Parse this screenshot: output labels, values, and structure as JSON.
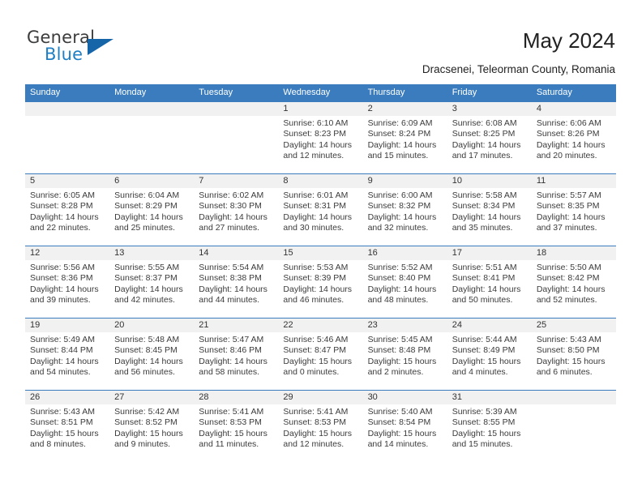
{
  "brand": {
    "name_top": "General",
    "name_bottom": "Blue",
    "accent_color": "#1f7fc4",
    "triangle_color": "#1565a8"
  },
  "header": {
    "title": "May 2024",
    "subtitle": "Dracsenei, Teleorman County, Romania"
  },
  "calendar": {
    "header_color": "#3a7cbe",
    "daynum_band_color": "#f1f1f1",
    "weekdays": [
      "Sunday",
      "Monday",
      "Tuesday",
      "Wednesday",
      "Thursday",
      "Friday",
      "Saturday"
    ],
    "weeks": [
      [
        {
          "day": "",
          "empty": true
        },
        {
          "day": "",
          "empty": true
        },
        {
          "day": "",
          "empty": true
        },
        {
          "day": "1",
          "sunrise": "Sunrise: 6:10 AM",
          "sunset": "Sunset: 8:23 PM",
          "daylight_l1": "Daylight: 14 hours",
          "daylight_l2": "and 12 minutes."
        },
        {
          "day": "2",
          "sunrise": "Sunrise: 6:09 AM",
          "sunset": "Sunset: 8:24 PM",
          "daylight_l1": "Daylight: 14 hours",
          "daylight_l2": "and 15 minutes."
        },
        {
          "day": "3",
          "sunrise": "Sunrise: 6:08 AM",
          "sunset": "Sunset: 8:25 PM",
          "daylight_l1": "Daylight: 14 hours",
          "daylight_l2": "and 17 minutes."
        },
        {
          "day": "4",
          "sunrise": "Sunrise: 6:06 AM",
          "sunset": "Sunset: 8:26 PM",
          "daylight_l1": "Daylight: 14 hours",
          "daylight_l2": "and 20 minutes."
        }
      ],
      [
        {
          "day": "5",
          "sunrise": "Sunrise: 6:05 AM",
          "sunset": "Sunset: 8:28 PM",
          "daylight_l1": "Daylight: 14 hours",
          "daylight_l2": "and 22 minutes."
        },
        {
          "day": "6",
          "sunrise": "Sunrise: 6:04 AM",
          "sunset": "Sunset: 8:29 PM",
          "daylight_l1": "Daylight: 14 hours",
          "daylight_l2": "and 25 minutes."
        },
        {
          "day": "7",
          "sunrise": "Sunrise: 6:02 AM",
          "sunset": "Sunset: 8:30 PM",
          "daylight_l1": "Daylight: 14 hours",
          "daylight_l2": "and 27 minutes."
        },
        {
          "day": "8",
          "sunrise": "Sunrise: 6:01 AM",
          "sunset": "Sunset: 8:31 PM",
          "daylight_l1": "Daylight: 14 hours",
          "daylight_l2": "and 30 minutes."
        },
        {
          "day": "9",
          "sunrise": "Sunrise: 6:00 AM",
          "sunset": "Sunset: 8:32 PM",
          "daylight_l1": "Daylight: 14 hours",
          "daylight_l2": "and 32 minutes."
        },
        {
          "day": "10",
          "sunrise": "Sunrise: 5:58 AM",
          "sunset": "Sunset: 8:34 PM",
          "daylight_l1": "Daylight: 14 hours",
          "daylight_l2": "and 35 minutes."
        },
        {
          "day": "11",
          "sunrise": "Sunrise: 5:57 AM",
          "sunset": "Sunset: 8:35 PM",
          "daylight_l1": "Daylight: 14 hours",
          "daylight_l2": "and 37 minutes."
        }
      ],
      [
        {
          "day": "12",
          "sunrise": "Sunrise: 5:56 AM",
          "sunset": "Sunset: 8:36 PM",
          "daylight_l1": "Daylight: 14 hours",
          "daylight_l2": "and 39 minutes."
        },
        {
          "day": "13",
          "sunrise": "Sunrise: 5:55 AM",
          "sunset": "Sunset: 8:37 PM",
          "daylight_l1": "Daylight: 14 hours",
          "daylight_l2": "and 42 minutes."
        },
        {
          "day": "14",
          "sunrise": "Sunrise: 5:54 AM",
          "sunset": "Sunset: 8:38 PM",
          "daylight_l1": "Daylight: 14 hours",
          "daylight_l2": "and 44 minutes."
        },
        {
          "day": "15",
          "sunrise": "Sunrise: 5:53 AM",
          "sunset": "Sunset: 8:39 PM",
          "daylight_l1": "Daylight: 14 hours",
          "daylight_l2": "and 46 minutes."
        },
        {
          "day": "16",
          "sunrise": "Sunrise: 5:52 AM",
          "sunset": "Sunset: 8:40 PM",
          "daylight_l1": "Daylight: 14 hours",
          "daylight_l2": "and 48 minutes."
        },
        {
          "day": "17",
          "sunrise": "Sunrise: 5:51 AM",
          "sunset": "Sunset: 8:41 PM",
          "daylight_l1": "Daylight: 14 hours",
          "daylight_l2": "and 50 minutes."
        },
        {
          "day": "18",
          "sunrise": "Sunrise: 5:50 AM",
          "sunset": "Sunset: 8:42 PM",
          "daylight_l1": "Daylight: 14 hours",
          "daylight_l2": "and 52 minutes."
        }
      ],
      [
        {
          "day": "19",
          "sunrise": "Sunrise: 5:49 AM",
          "sunset": "Sunset: 8:44 PM",
          "daylight_l1": "Daylight: 14 hours",
          "daylight_l2": "and 54 minutes."
        },
        {
          "day": "20",
          "sunrise": "Sunrise: 5:48 AM",
          "sunset": "Sunset: 8:45 PM",
          "daylight_l1": "Daylight: 14 hours",
          "daylight_l2": "and 56 minutes."
        },
        {
          "day": "21",
          "sunrise": "Sunrise: 5:47 AM",
          "sunset": "Sunset: 8:46 PM",
          "daylight_l1": "Daylight: 14 hours",
          "daylight_l2": "and 58 minutes."
        },
        {
          "day": "22",
          "sunrise": "Sunrise: 5:46 AM",
          "sunset": "Sunset: 8:47 PM",
          "daylight_l1": "Daylight: 15 hours",
          "daylight_l2": "and 0 minutes."
        },
        {
          "day": "23",
          "sunrise": "Sunrise: 5:45 AM",
          "sunset": "Sunset: 8:48 PM",
          "daylight_l1": "Daylight: 15 hours",
          "daylight_l2": "and 2 minutes."
        },
        {
          "day": "24",
          "sunrise": "Sunrise: 5:44 AM",
          "sunset": "Sunset: 8:49 PM",
          "daylight_l1": "Daylight: 15 hours",
          "daylight_l2": "and 4 minutes."
        },
        {
          "day": "25",
          "sunrise": "Sunrise: 5:43 AM",
          "sunset": "Sunset: 8:50 PM",
          "daylight_l1": "Daylight: 15 hours",
          "daylight_l2": "and 6 minutes."
        }
      ],
      [
        {
          "day": "26",
          "sunrise": "Sunrise: 5:43 AM",
          "sunset": "Sunset: 8:51 PM",
          "daylight_l1": "Daylight: 15 hours",
          "daylight_l2": "and 8 minutes."
        },
        {
          "day": "27",
          "sunrise": "Sunrise: 5:42 AM",
          "sunset": "Sunset: 8:52 PM",
          "daylight_l1": "Daylight: 15 hours",
          "daylight_l2": "and 9 minutes."
        },
        {
          "day": "28",
          "sunrise": "Sunrise: 5:41 AM",
          "sunset": "Sunset: 8:53 PM",
          "daylight_l1": "Daylight: 15 hours",
          "daylight_l2": "and 11 minutes."
        },
        {
          "day": "29",
          "sunrise": "Sunrise: 5:41 AM",
          "sunset": "Sunset: 8:53 PM",
          "daylight_l1": "Daylight: 15 hours",
          "daylight_l2": "and 12 minutes."
        },
        {
          "day": "30",
          "sunrise": "Sunrise: 5:40 AM",
          "sunset": "Sunset: 8:54 PM",
          "daylight_l1": "Daylight: 15 hours",
          "daylight_l2": "and 14 minutes."
        },
        {
          "day": "31",
          "sunrise": "Sunrise: 5:39 AM",
          "sunset": "Sunset: 8:55 PM",
          "daylight_l1": "Daylight: 15 hours",
          "daylight_l2": "and 15 minutes."
        },
        {
          "day": "",
          "empty": true
        }
      ]
    ]
  }
}
